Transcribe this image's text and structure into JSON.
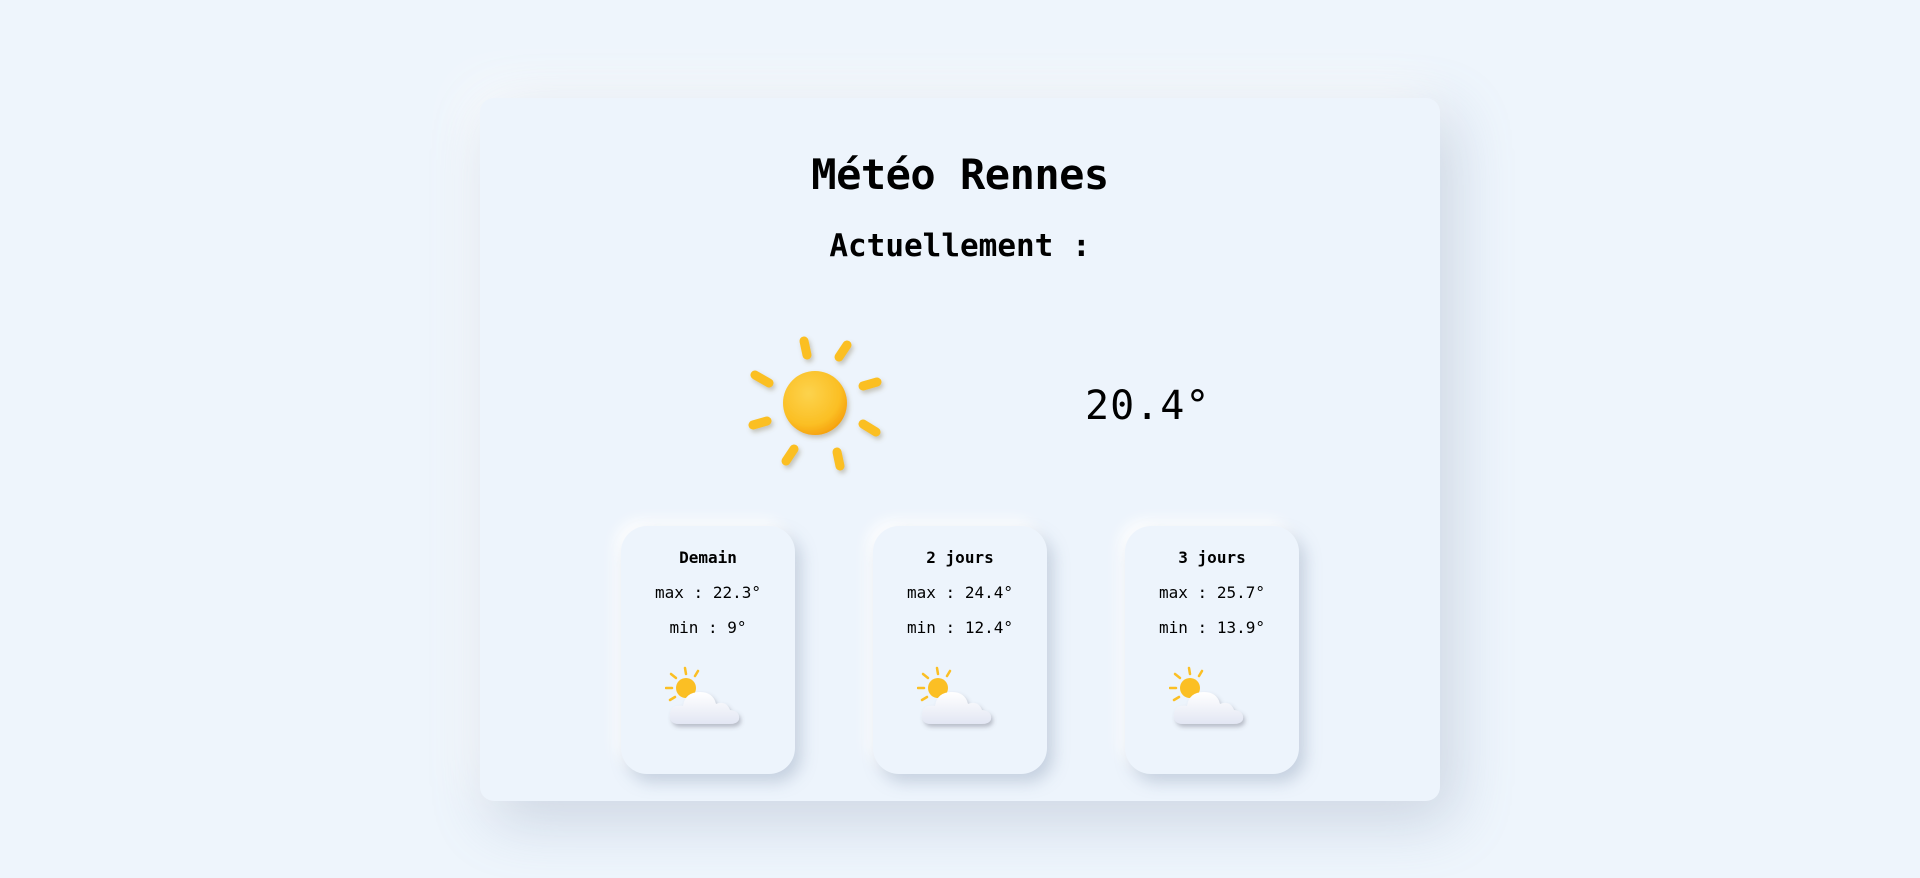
{
  "header": {
    "title": "Météo Rennes",
    "subtitle": "Actuellement :"
  },
  "current": {
    "icon": "sun-icon",
    "temperature": "20.4°"
  },
  "forecast": [
    {
      "label": "Demain",
      "max": "max : 22.3°",
      "min": "min : 9°",
      "icon": "partly-cloudy-icon"
    },
    {
      "label": "2 jours",
      "max": "max : 24.4°",
      "min": "min : 12.4°",
      "icon": "partly-cloudy-icon"
    },
    {
      "label": "3 jours",
      "max": "max : 25.7°",
      "min": "min : 13.9°",
      "icon": "partly-cloudy-icon"
    }
  ],
  "colors": {
    "background": "#eef5fc",
    "sun": "#fbbf24",
    "sun_dark": "#f59e0b",
    "cloud": "#ffffff"
  }
}
